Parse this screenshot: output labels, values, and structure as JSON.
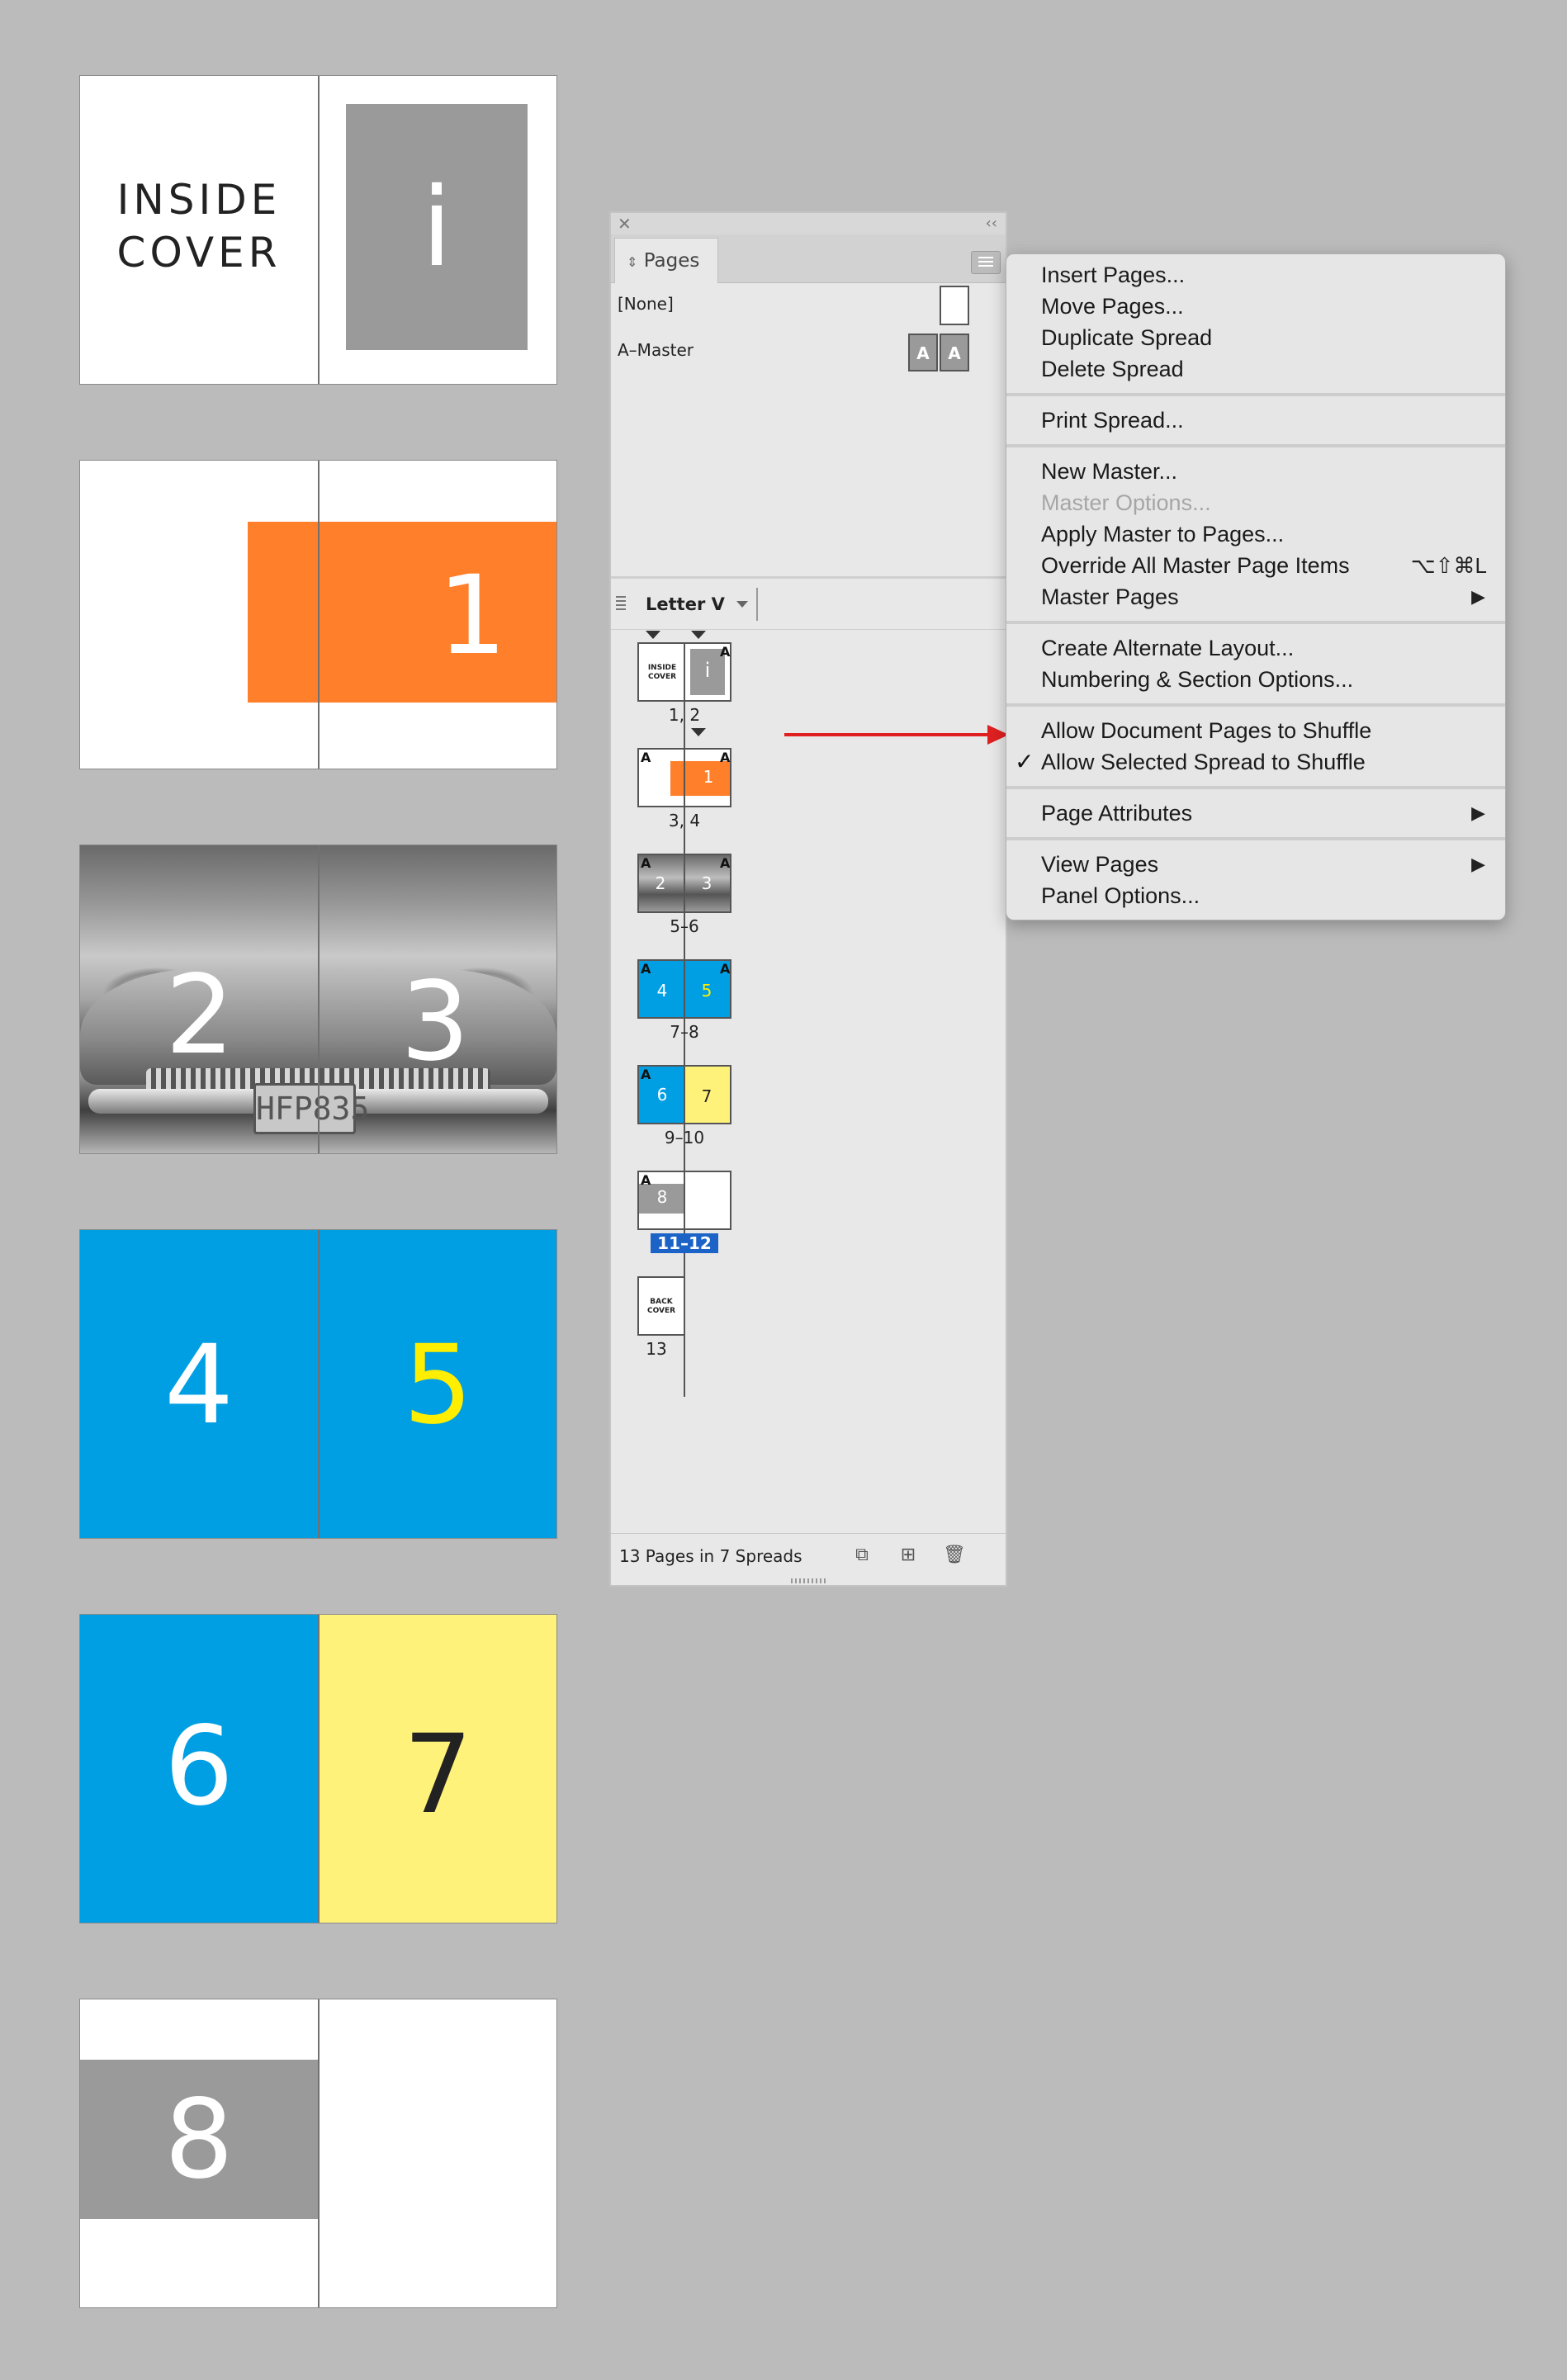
{
  "spreads": {
    "inside_cover": {
      "text_line1": "INSIDE",
      "text_line2": "COVER",
      "page_i": "i"
    },
    "spread_1": {
      "number": "1"
    },
    "spread_2_3": {
      "left": "2",
      "right": "3",
      "plate": "HFP835"
    },
    "spread_4_5": {
      "left": "4",
      "right": "5"
    },
    "spread_6_7": {
      "left": "6",
      "right": "7"
    },
    "spread_8": {
      "number": "8"
    }
  },
  "colors": {
    "orange": "#ff7f2a",
    "blue": "#009fe3",
    "yellow": "#fff27a",
    "gray": "#9a9a9a",
    "selection": "#1b63c7",
    "arrow": "#e02020"
  },
  "panel": {
    "tab_label": "Pages",
    "masters": {
      "none_label": "[None]",
      "a_master_label": "A–Master",
      "a_letter": "A"
    },
    "page_size": "Letter V",
    "thumbnails": [
      {
        "label": "1, 2",
        "left_text": "INSIDE COVER",
        "right_num": "i"
      },
      {
        "label": "3, 4",
        "num": "1"
      },
      {
        "label": "5–6",
        "left_num": "2",
        "right_num": "3"
      },
      {
        "label": "7–8",
        "left_num": "4",
        "right_num": "5"
      },
      {
        "label": "9–10",
        "left_num": "6",
        "right_num": "7"
      },
      {
        "label": "11–12",
        "num": "8",
        "selected": true
      },
      {
        "label": "13",
        "text": "BACK COVER"
      }
    ],
    "footer": "13 Pages in 7 Spreads",
    "icons": [
      "close-icon",
      "collapse-icon",
      "panel-menu-icon",
      "edit-page-size-icon",
      "new-page-icon",
      "trash-icon"
    ]
  },
  "menu": {
    "insert_pages": "Insert Pages...",
    "move_pages": "Move Pages...",
    "duplicate_spread": "Duplicate Spread",
    "delete_spread": "Delete Spread",
    "print_spread": "Print Spread...",
    "new_master": "New Master...",
    "master_options": "Master Options...",
    "apply_master": "Apply Master to Pages...",
    "override_all": "Override All Master Page Items",
    "override_shortcut": "⌥⇧⌘L",
    "master_pages": "Master Pages",
    "create_alt_layout": "Create Alternate Layout...",
    "numbering": "Numbering & Section Options...",
    "allow_doc_shuffle": "Allow Document Pages to Shuffle",
    "allow_spread_shuffle": "Allow Selected Spread to Shuffle",
    "page_attributes": "Page Attributes",
    "view_pages": "View Pages",
    "panel_options": "Panel Options...",
    "submenu_arrow": "▶",
    "checkmark": "✓"
  }
}
